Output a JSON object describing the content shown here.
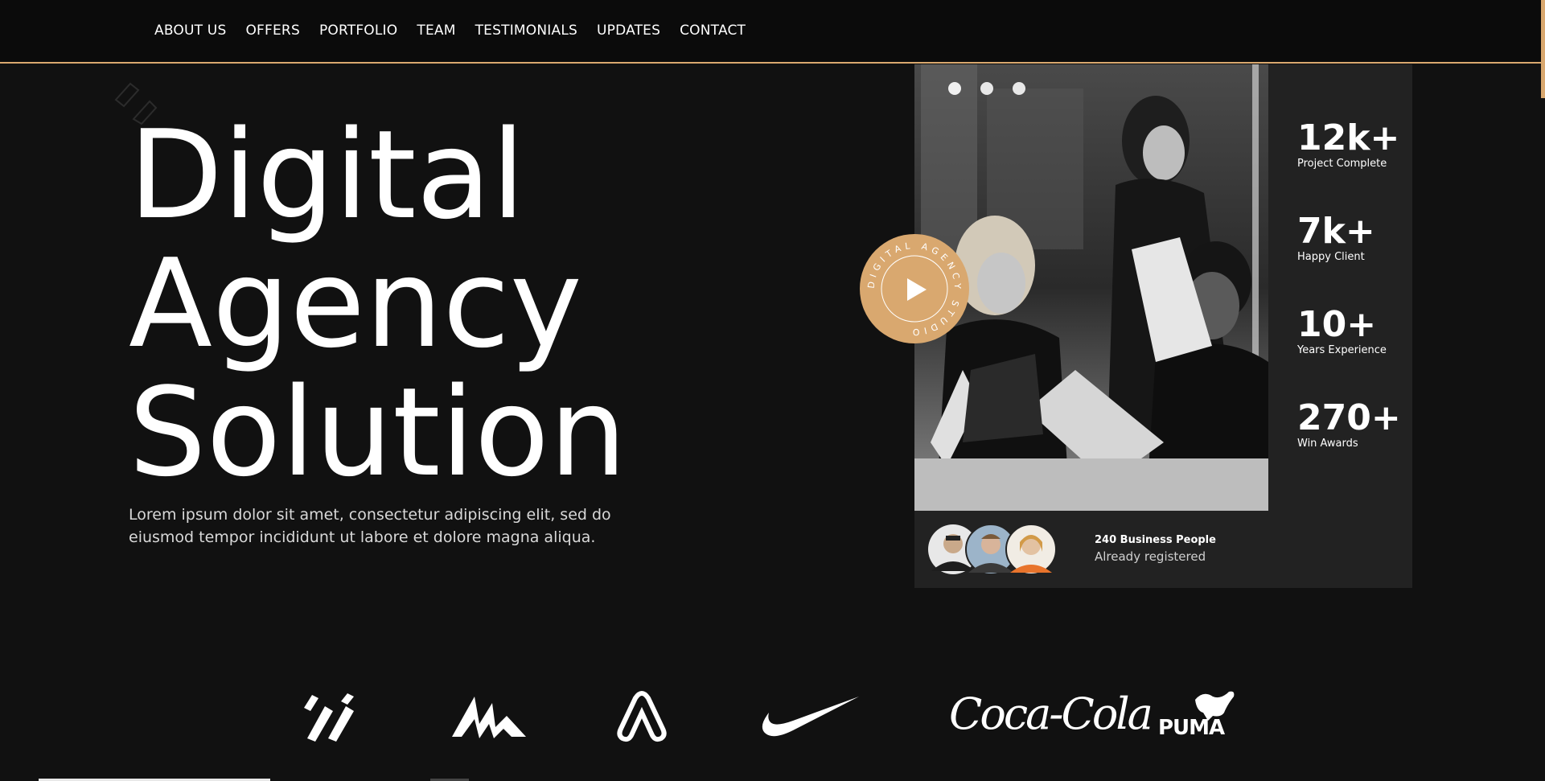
{
  "nav": {
    "items": [
      "ABOUT US",
      "OFFERS",
      "PORTFOLIO",
      "TEAM",
      "TESTIMONIALS",
      "UPDATES",
      "CONTACT"
    ]
  },
  "hero": {
    "title_lines": [
      "Digital",
      "Agency",
      "Solution"
    ],
    "description": "Lorem ipsum dolor sit amet, consectetur adipiscing elit, sed do eiusmod tempor incididunt ut labore et dolore magna aliqua."
  },
  "badge": {
    "circular_text": "DIGITAL AGENCY STUDIO",
    "icon": "play-icon"
  },
  "stats": [
    {
      "value": "12k+",
      "label": "Project Complete"
    },
    {
      "value": "7k+",
      "label": "Happy Client"
    },
    {
      "value": "10+",
      "label": "Years Experience"
    },
    {
      "value": "270+",
      "label": "Win Awards"
    }
  ],
  "registered": {
    "count_text": "240 Business People",
    "sub_text": "Already registered"
  },
  "logos": [
    "brand-logo-1",
    "brand-logo-2",
    "brand-logo-3",
    "nike-logo",
    "coca-cola-logo",
    "puma-logo"
  ],
  "logo_text": {
    "coca_cola": "Coca-Cola",
    "puma": "PUMA"
  },
  "colors": {
    "accent": "#d9a86f",
    "background": "#111111",
    "card": "#222222"
  }
}
